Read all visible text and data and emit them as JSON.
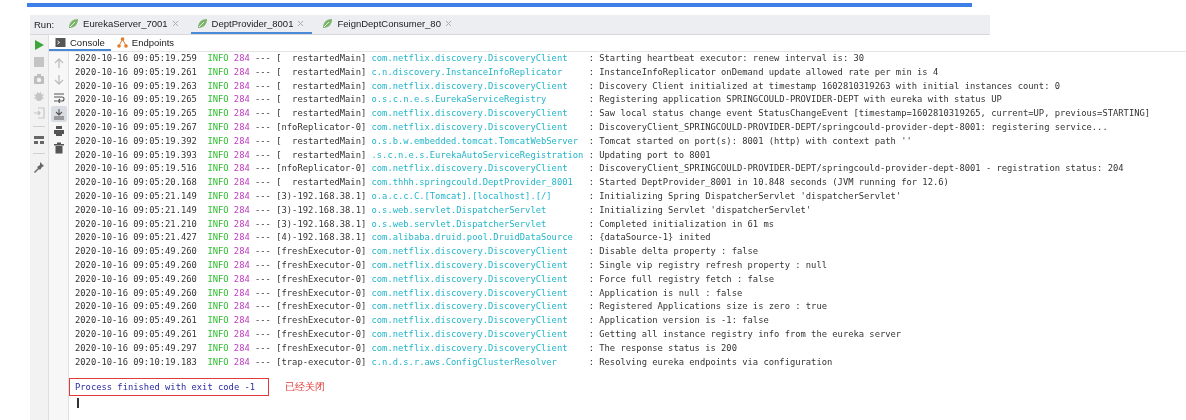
{
  "run_bar": {
    "label": "Run:",
    "tabs": [
      {
        "label": "EurekaServer_7001",
        "selected": false
      },
      {
        "label": "DeptProvider_8001",
        "selected": true
      },
      {
        "label": "FeignDeptConsumer_80",
        "selected": false
      }
    ]
  },
  "side_tools": [
    {
      "kind": "run"
    },
    {
      "kind": "stop"
    },
    {
      "kind": "camera"
    },
    {
      "kind": "bug"
    },
    {
      "kind": "login"
    },
    {
      "kind": "layout"
    },
    {
      "kind": "pin"
    }
  ],
  "console_tabs": [
    {
      "label": "Console",
      "kind": "console",
      "selected": true
    },
    {
      "label": "Endpoints",
      "kind": "endpoints",
      "selected": false
    }
  ],
  "console_tools": [
    {
      "kind": "up",
      "on": false
    },
    {
      "kind": "down",
      "on": false
    },
    {
      "kind": "wrap",
      "on": false
    },
    {
      "kind": "scroll-end",
      "on": true
    },
    {
      "kind": "print",
      "on": false
    },
    {
      "kind": "trash",
      "on": false
    }
  ],
  "log": [
    {
      "time": "2020-10-16 09:05:19.259",
      "level": "INFO",
      "pid": "284",
      "sep": "---",
      "thread": "[  restartedMain]",
      "logger": "com.netflix.discovery.DiscoveryClient",
      "message": ": Starting heartbeat executor: renew interval is: 30"
    },
    {
      "time": "2020-10-16 09:05:19.261",
      "level": "INFO",
      "pid": "284",
      "sep": "---",
      "thread": "[  restartedMain]",
      "logger": "c.n.discovery.InstanceInfoReplicator",
      "message": ": InstanceInfoReplicator onDemand update allowed rate per min is 4"
    },
    {
      "time": "2020-10-16 09:05:19.263",
      "level": "INFO",
      "pid": "284",
      "sep": "---",
      "thread": "[  restartedMain]",
      "logger": "com.netflix.discovery.DiscoveryClient",
      "message": ": Discovery Client initialized at timestamp 1602810319263 with initial instances count: 0"
    },
    {
      "time": "2020-10-16 09:05:19.265",
      "level": "INFO",
      "pid": "284",
      "sep": "---",
      "thread": "[  restartedMain]",
      "logger": "o.s.c.n.e.s.EurekaServiceRegistry",
      "message": ": Registering application SPRINGCOULD-PROVIDER-DEPT with eureka with status UP"
    },
    {
      "time": "2020-10-16 09:05:19.265",
      "level": "INFO",
      "pid": "284",
      "sep": "---",
      "thread": "[  restartedMain]",
      "logger": "com.netflix.discovery.DiscoveryClient",
      "message": ": Saw local status change event StatusChangeEvent [timestamp=1602810319265, current=UP, previous=STARTING]"
    },
    {
      "time": "2020-10-16 09:05:19.267",
      "level": "INFO",
      "pid": "284",
      "sep": "---",
      "thread": "[nfoReplicator-0]",
      "logger": "com.netflix.discovery.DiscoveryClient",
      "message": ": DiscoveryClient_SPRINGCOULD-PROVIDER-DEPT/springcould-provider-dept-8001: registering service..."
    },
    {
      "time": "2020-10-16 09:05:19.392",
      "level": "INFO",
      "pid": "284",
      "sep": "---",
      "thread": "[  restartedMain]",
      "logger": "o.s.b.w.embedded.tomcat.TomcatWebServer",
      "message": ": Tomcat started on port(s): 8001 (http) with context path ''"
    },
    {
      "time": "2020-10-16 09:05:19.393",
      "level": "INFO",
      "pid": "284",
      "sep": "---",
      "thread": "[  restartedMain]",
      "logger": ".s.c.n.e.s.EurekaAutoServiceRegistration",
      "message": ": Updating port to 8001"
    },
    {
      "time": "2020-10-16 09:05:19.516",
      "level": "INFO",
      "pid": "284",
      "sep": "---",
      "thread": "[nfoReplicator-0]",
      "logger": "com.netflix.discovery.DiscoveryClient",
      "message": ": DiscoveryClient_SPRINGCOULD-PROVIDER-DEPT/springcould-provider-dept-8001 - registration status: 204"
    },
    {
      "time": "2020-10-16 09:05:20.168",
      "level": "INFO",
      "pid": "284",
      "sep": "---",
      "thread": "[  restartedMain]",
      "logger": "com.thhh.springcould.DeptProvider_8001",
      "message": ": Started DeptProvider_8001 in 10.848 seconds (JVM running for 12.6)"
    },
    {
      "time": "2020-10-16 09:05:21.149",
      "level": "INFO",
      "pid": "284",
      "sep": "---",
      "thread": "[3)-192.168.38.1]",
      "logger": "o.a.c.c.C.[Tomcat].[localhost].[/]",
      "message": ": Initializing Spring DispatcherServlet 'dispatcherServlet'"
    },
    {
      "time": "2020-10-16 09:05:21.149",
      "level": "INFO",
      "pid": "284",
      "sep": "---",
      "thread": "[3)-192.168.38.1]",
      "logger": "o.s.web.servlet.DispatcherServlet",
      "message": ": Initializing Servlet 'dispatcherServlet'"
    },
    {
      "time": "2020-10-16 09:05:21.210",
      "level": "INFO",
      "pid": "284",
      "sep": "---",
      "thread": "[3)-192.168.38.1]",
      "logger": "o.s.web.servlet.DispatcherServlet",
      "message": ": Completed initialization in 61 ms"
    },
    {
      "time": "2020-10-16 09:05:21.427",
      "level": "INFO",
      "pid": "284",
      "sep": "---",
      "thread": "[4)-192.168.38.1]",
      "logger": "com.alibaba.druid.pool.DruidDataSource",
      "message": ": {dataSource-1} inited"
    },
    {
      "time": "2020-10-16 09:05:49.260",
      "level": "INFO",
      "pid": "284",
      "sep": "---",
      "thread": "[freshExecutor-0]",
      "logger": "com.netflix.discovery.DiscoveryClient",
      "message": ": Disable delta property : false"
    },
    {
      "time": "2020-10-16 09:05:49.260",
      "level": "INFO",
      "pid": "284",
      "sep": "---",
      "thread": "[freshExecutor-0]",
      "logger": "com.netflix.discovery.DiscoveryClient",
      "message": ": Single vip registry refresh property : null"
    },
    {
      "time": "2020-10-16 09:05:49.260",
      "level": "INFO",
      "pid": "284",
      "sep": "---",
      "thread": "[freshExecutor-0]",
      "logger": "com.netflix.discovery.DiscoveryClient",
      "message": ": Force full registry fetch : false"
    },
    {
      "time": "2020-10-16 09:05:49.260",
      "level": "INFO",
      "pid": "284",
      "sep": "---",
      "thread": "[freshExecutor-0]",
      "logger": "com.netflix.discovery.DiscoveryClient",
      "message": ": Application is null : false"
    },
    {
      "time": "2020-10-16 09:05:49.260",
      "level": "INFO",
      "pid": "284",
      "sep": "---",
      "thread": "[freshExecutor-0]",
      "logger": "com.netflix.discovery.DiscoveryClient",
      "message": ": Registered Applications size is zero : true"
    },
    {
      "time": "2020-10-16 09:05:49.261",
      "level": "INFO",
      "pid": "284",
      "sep": "---",
      "thread": "[freshExecutor-0]",
      "logger": "com.netflix.discovery.DiscoveryClient",
      "message": ": Application version is -1: false"
    },
    {
      "time": "2020-10-16 09:05:49.261",
      "level": "INFO",
      "pid": "284",
      "sep": "---",
      "thread": "[freshExecutor-0]",
      "logger": "com.netflix.discovery.DiscoveryClient",
      "message": ": Getting all instance registry info from the eureka server"
    },
    {
      "time": "2020-10-16 09:05:49.297",
      "level": "INFO",
      "pid": "284",
      "sep": "---",
      "thread": "[freshExecutor-0]",
      "logger": "com.netflix.discovery.DiscoveryClient",
      "message": ": The response status is 200"
    },
    {
      "time": "2020-10-16 09:10:19.183",
      "level": "INFO",
      "pid": "284",
      "sep": "---",
      "thread": "[trap-executor-0]",
      "logger": "c.n.d.s.r.aws.ConfigClusterResolver",
      "message": ": Resolving eureka endpoints via configuration"
    }
  ],
  "exit_message": "Process finished with exit code -1",
  "annotation": "已经关闭"
}
